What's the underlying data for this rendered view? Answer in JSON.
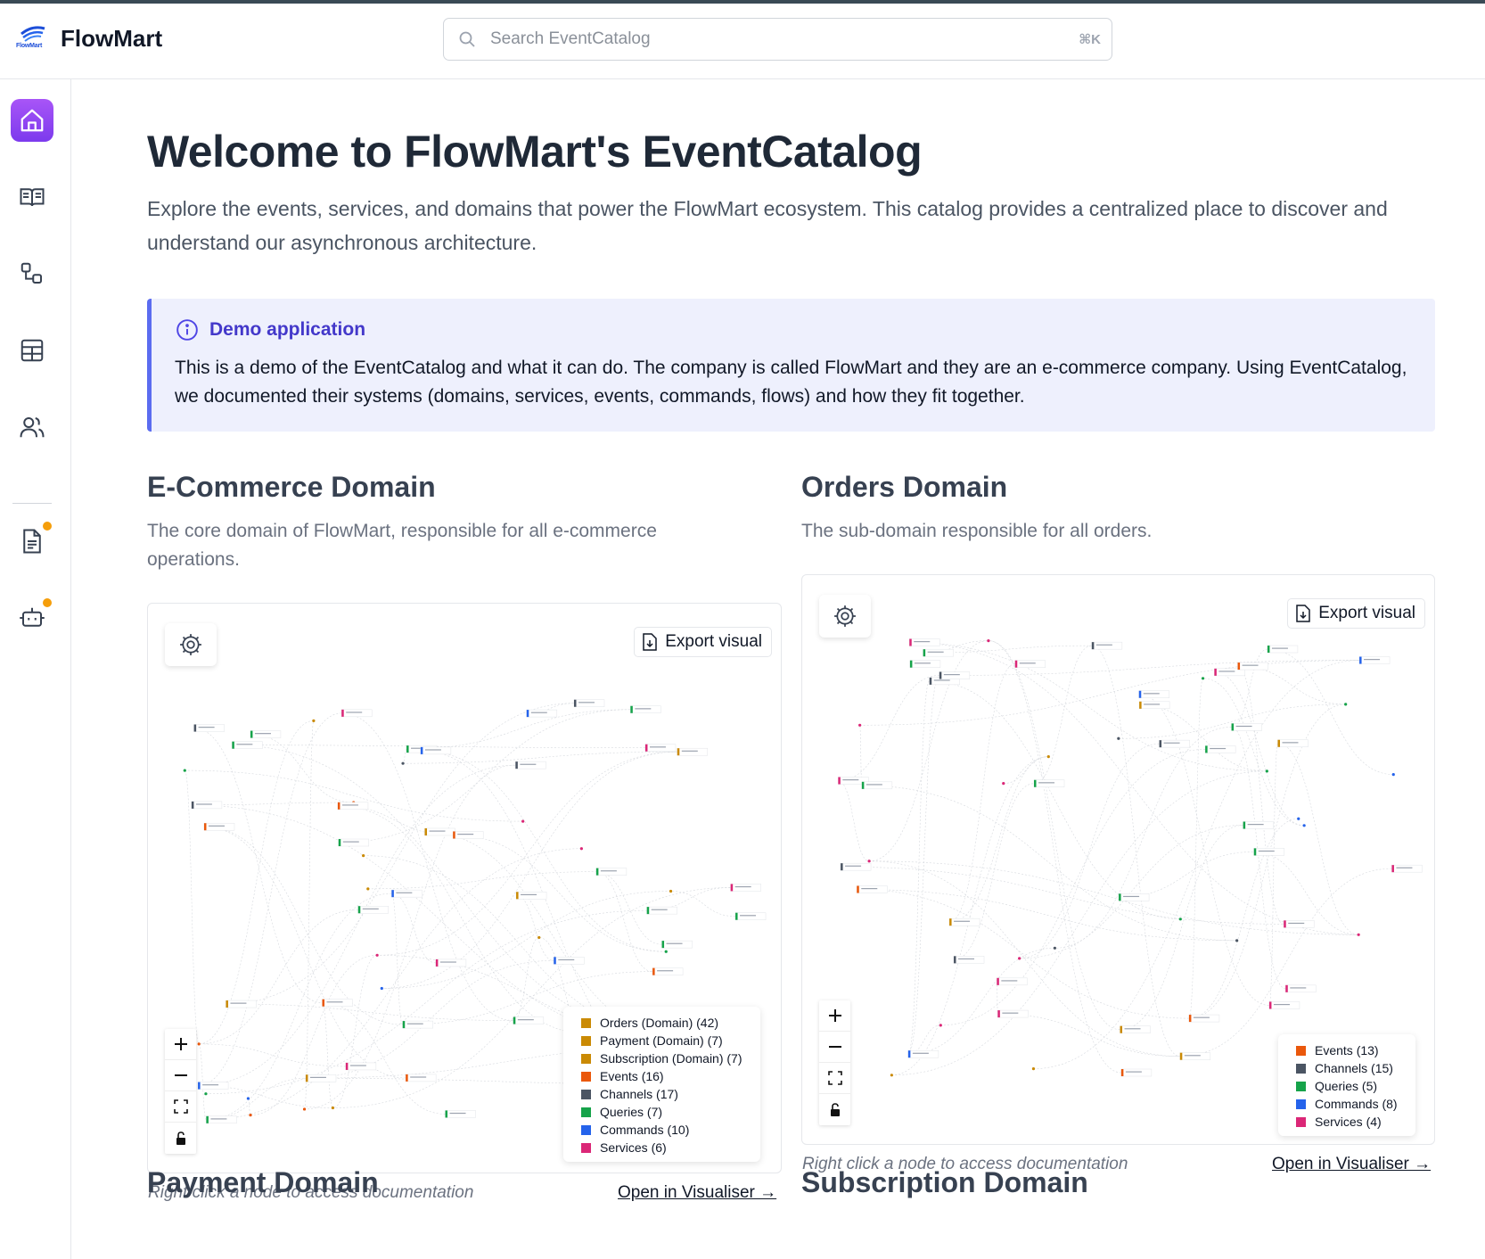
{
  "brand": {
    "name": "FlowMart",
    "logo_text": "FlowMart"
  },
  "search": {
    "placeholder": "Search EventCatalog",
    "shortcut": "⌘K"
  },
  "sidebar": {
    "items": [
      {
        "icon": "home-icon",
        "active": true
      },
      {
        "icon": "book-icon",
        "active": false
      },
      {
        "icon": "flow-icon",
        "active": false
      },
      {
        "icon": "table-icon",
        "active": false
      },
      {
        "icon": "users-icon",
        "active": false
      },
      {
        "icon": "document-icon",
        "active": false,
        "badge": true
      },
      {
        "icon": "bot-icon",
        "active": false,
        "badge": true
      }
    ]
  },
  "page": {
    "title": "Welcome to FlowMart's EventCatalog",
    "intro": "Explore the events, services, and domains that power the FlowMart ecosystem. This catalog provides a centralized place to discover and understand our asynchronous architecture."
  },
  "callout": {
    "title": "Demo application",
    "body": "This is a demo of the EventCatalog and what it can do. The company is called FlowMart and they are an e-commerce company. Using EventCatalog, we documented their systems (domains, services, events, commands, flows) and how they fit together."
  },
  "domains": [
    {
      "title": "E-Commerce Domain",
      "description": "The core domain of FlowMart, responsible for all e-commerce operations.",
      "export_label": "Export visual",
      "legend": [
        {
          "label": "Orders (Domain) (42)",
          "color": "#ca8a04"
        },
        {
          "label": "Payment (Domain) (7)",
          "color": "#ca8a04"
        },
        {
          "label": "Subscription (Domain) (7)",
          "color": "#ca8a04"
        },
        {
          "label": "Events (16)",
          "color": "#ea580c"
        },
        {
          "label": "Channels (17)",
          "color": "#4b5563"
        },
        {
          "label": "Queries (7)",
          "color": "#16a34a"
        },
        {
          "label": "Commands (10)",
          "color": "#2563eb"
        },
        {
          "label": "Services (6)",
          "color": "#db2777"
        }
      ],
      "note": "Right click a node to access documentation",
      "link": "Open in Visualiser →"
    },
    {
      "title": "Orders Domain",
      "description": "The sub-domain responsible for all orders.",
      "export_label": "Export visual",
      "legend": [
        {
          "label": "Events (13)",
          "color": "#ea580c"
        },
        {
          "label": "Channels (15)",
          "color": "#4b5563"
        },
        {
          "label": "Queries (5)",
          "color": "#16a34a"
        },
        {
          "label": "Commands (8)",
          "color": "#2563eb"
        },
        {
          "label": "Services (4)",
          "color": "#db2777"
        }
      ],
      "note": "Right click a node to access documentation",
      "link": "Open in Visualiser →"
    }
  ],
  "next_sections": [
    "Payment Domain",
    "Subscription Domain"
  ],
  "colors": {
    "accent": "#7c3aed",
    "callout_border": "#5b6cf0",
    "callout_bg": "#eef0fd",
    "badge": "#f59e0b"
  }
}
